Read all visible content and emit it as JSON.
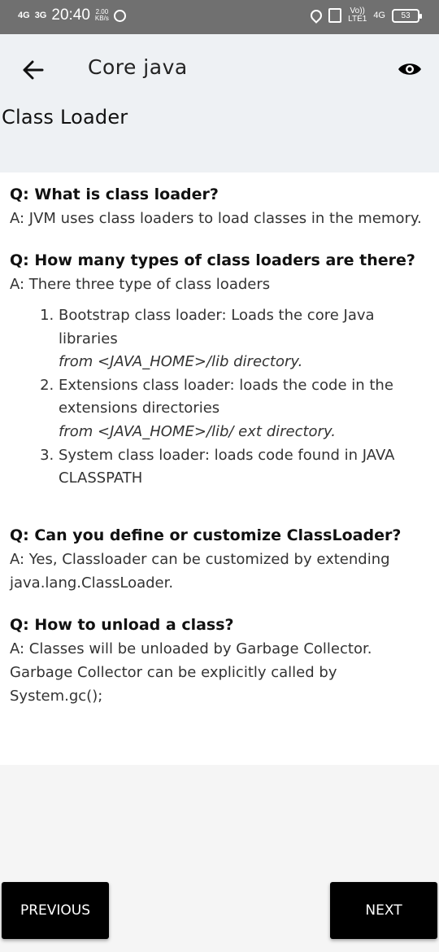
{
  "status_bar": {
    "signal_1": "4G",
    "signal_2": "3G",
    "time": "20:40",
    "net_speed_value": "2.00",
    "net_speed_unit": "KB/s",
    "volte_top": "Vo))",
    "volte_bottom": "LTE1",
    "network": "4G",
    "battery": "53"
  },
  "app_bar": {
    "title": "Core java",
    "topic": "Class Loader"
  },
  "qa": [
    {
      "q": "Q:  What is class loader?",
      "a": "A: JVM uses class loaders to load classes in the memory."
    },
    {
      "q": "Q: How many types of class loaders are there?",
      "a": "A: There three type of class loaders",
      "list": [
        {
          "line1": "Bootstrap class loader: Loads the core Java libraries",
          "line2": "from <JAVA_HOME>/lib directory."
        },
        {
          "line1": "Extensions class loader: loads the code in the extensions directories",
          "line2": "from <JAVA_HOME>/lib/ ext directory."
        },
        {
          "line1": "System class loader: loads code found in JAVA CLASSPATH",
          "line2": ""
        }
      ]
    },
    {
      "q": "Q: Can you define or customize ClassLoader?",
      "a": "A: Yes, Classloader can be customized by extending java.lang.ClassLoader."
    },
    {
      "q": "Q: How to unload a class?",
      "a": "A: Classes will be unloaded by Garbage Collector.  Garbage Collector can be explicitly called by System.gc();"
    }
  ],
  "buttons": {
    "previous": "PREVIOUS",
    "next": "NEXT"
  }
}
